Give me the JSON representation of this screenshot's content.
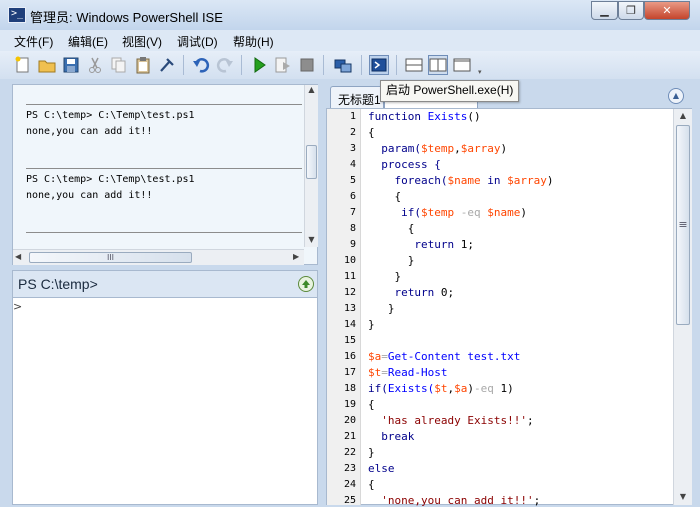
{
  "window": {
    "title": "管理员: Windows PowerShell ISE",
    "app_icon_glyph": ">_",
    "minimize_glyph": "▁",
    "restore_glyph": "❐",
    "close_glyph": "✕"
  },
  "menu": {
    "items": [
      "文件(F)",
      "编辑(E)",
      "视图(V)",
      "调试(D)",
      "帮助(H)"
    ]
  },
  "toolbar": {
    "buttons": [
      "new-icon",
      "open-icon",
      "save-icon",
      "cut-icon",
      "copy-icon",
      "paste-icon",
      "clear-icon",
      "undo-icon",
      "redo-icon",
      "run-icon",
      "run-selection-icon",
      "stop-icon",
      "remote-icon",
      "powershell-icon",
      "layout-top-icon",
      "layout-side-icon",
      "layout-max-icon"
    ],
    "tooltip": "启动 PowerShell.exe(H)"
  },
  "output": {
    "entries": [
      {
        "command": "PS C:\\temp> C:\\Temp\\test.ps1",
        "result": "none,you can add it!!"
      },
      {
        "command": "PS C:\\temp> C:\\Temp\\test.ps1",
        "result": "none,you can add it!!"
      }
    ],
    "hscroll_grip": "III"
  },
  "command_pane": {
    "prompt": "PS C:\\temp>",
    "caret": ">"
  },
  "editor": {
    "tabs": [
      {
        "label": "无标题1"
      },
      {
        "label": ""
      }
    ],
    "line_numbers": [
      "1",
      "2",
      "3",
      "4",
      "5",
      "6",
      "7",
      "8",
      "9",
      "10",
      "11",
      "12",
      "13",
      "14",
      "15",
      "16",
      "17",
      "18",
      "19",
      "20",
      "21",
      "22",
      "23",
      "24",
      "25"
    ],
    "code_lines": [
      [
        {
          "t": "function ",
          "c": "kw"
        },
        {
          "t": "Exists",
          "c": "cmd"
        },
        {
          "t": "()",
          "c": ""
        }
      ],
      [
        {
          "t": "{",
          "c": ""
        }
      ],
      [
        {
          "t": "  param(",
          "c": "kw"
        },
        {
          "t": "$temp",
          "c": "var"
        },
        {
          "t": ",",
          "c": ""
        },
        {
          "t": "$array",
          "c": "var"
        },
        {
          "t": ")",
          "c": ""
        }
      ],
      [
        {
          "t": "  process {",
          "c": "kw"
        }
      ],
      [
        {
          "t": "    foreach(",
          "c": "kw"
        },
        {
          "t": "$name",
          "c": "var"
        },
        {
          "t": " in ",
          "c": "kw"
        },
        {
          "t": "$array",
          "c": "var"
        },
        {
          "t": ")",
          "c": ""
        }
      ],
      [
        {
          "t": "    {",
          "c": ""
        }
      ],
      [
        {
          "t": "     if(",
          "c": "kw"
        },
        {
          "t": "$temp",
          "c": "var"
        },
        {
          "t": " -eq ",
          "c": "op"
        },
        {
          "t": "$name",
          "c": "var"
        },
        {
          "t": ")",
          "c": ""
        }
      ],
      [
        {
          "t": "      {",
          "c": ""
        }
      ],
      [
        {
          "t": "       return ",
          "c": "kw"
        },
        {
          "t": "1;",
          "c": ""
        }
      ],
      [
        {
          "t": "      }",
          "c": ""
        }
      ],
      [
        {
          "t": "    }",
          "c": ""
        }
      ],
      [
        {
          "t": "    return ",
          "c": "kw"
        },
        {
          "t": "0;",
          "c": ""
        }
      ],
      [
        {
          "t": "   }",
          "c": ""
        }
      ],
      [
        {
          "t": "}",
          "c": ""
        }
      ],
      [
        {
          "t": "",
          "c": ""
        }
      ],
      [
        {
          "t": "$a",
          "c": "var"
        },
        {
          "t": "=",
          "c": "op"
        },
        {
          "t": "Get-Content ",
          "c": "cmd"
        },
        {
          "t": "test.txt",
          "c": "cmd"
        }
      ],
      [
        {
          "t": "$t",
          "c": "var"
        },
        {
          "t": "=",
          "c": "op"
        },
        {
          "t": "Read-Host",
          "c": "cmd"
        }
      ],
      [
        {
          "t": "if(",
          "c": "kw"
        },
        {
          "t": "Exists(",
          "c": "cmd"
        },
        {
          "t": "$t",
          "c": "var"
        },
        {
          "t": ",",
          "c": ""
        },
        {
          "t": "$a",
          "c": "var"
        },
        {
          "t": ")",
          "c": ""
        },
        {
          "t": "-eq ",
          "c": "op"
        },
        {
          "t": "1)",
          "c": ""
        }
      ],
      [
        {
          "t": "{",
          "c": ""
        }
      ],
      [
        {
          "t": "  'has already Exists!!'",
          "c": "str"
        },
        {
          "t": ";",
          "c": ""
        }
      ],
      [
        {
          "t": "  break",
          "c": "kw"
        }
      ],
      [
        {
          "t": "}",
          "c": ""
        }
      ],
      [
        {
          "t": "else",
          "c": "kw"
        }
      ],
      [
        {
          "t": "{",
          "c": ""
        }
      ],
      [
        {
          "t": "  'none,you can add it!!'",
          "c": "str"
        },
        {
          "t": ";",
          "c": ""
        }
      ]
    ],
    "vscroll_grip": "≡",
    "collapse_glyph": "▲"
  },
  "colors": {
    "keyword": "#00008b",
    "variable": "#ff4500",
    "string": "#8b0000",
    "operator": "#a9a9a9",
    "command": "#0000ff"
  }
}
